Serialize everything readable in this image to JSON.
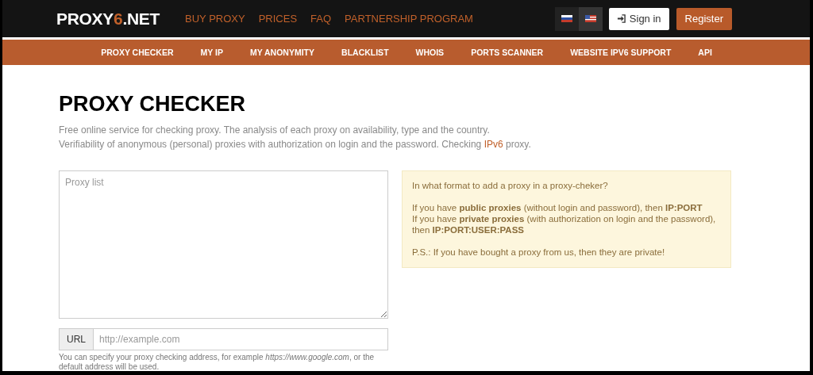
{
  "header": {
    "logo": [
      {
        "text": "PROXY",
        "accent": false
      },
      {
        "text": "6",
        "accent": true
      },
      {
        "text": ".NET",
        "accent": false
      }
    ],
    "menu": [
      "BUY PROXY",
      "PRICES",
      "FAQ",
      "PARTNERSHIP PROGRAM"
    ],
    "languages": [
      {
        "kind": "ru",
        "selected": false
      },
      {
        "kind": "us",
        "selected": true
      }
    ],
    "sign_in": "Sign in",
    "register": "Register"
  },
  "nav": [
    "PROXY CHECKER",
    "MY IP",
    "MY ANONYMITY",
    "BLACKLIST",
    "WHOIS",
    "PORTS SCANNER",
    "WEBSITE IPV6 SUPPORT",
    "API"
  ],
  "page": {
    "title": "PROXY CHECKER",
    "intro": "Free online service for checking proxy. The analysis of each proxy on availability, type and the country.",
    "intro2_before": "Verifiability of anonymous (personal) proxies with authorization on login and the password. Checking ",
    "intro2_link": "IPv6",
    "intro2_after": " proxy.",
    "proxy_list": {
      "placeholder": "Proxy list"
    },
    "url": {
      "label": "URL",
      "placeholder": "http://example.com"
    },
    "url_help": "You can specify your proxy checking address, for example *https://www.google.com*, or the default address will be used.",
    "info": [
      "In what format to add a proxy in a proxy-cheker?",
      "If you have **public proxies** (without login and password), then **IP:PORT**",
      "If you have **private proxies** (with authorization on login and the password), then **IP:PORT:USER:PASS**",
      "P.S.: If you have bought a proxy from us, then they are private!"
    ]
  }
}
